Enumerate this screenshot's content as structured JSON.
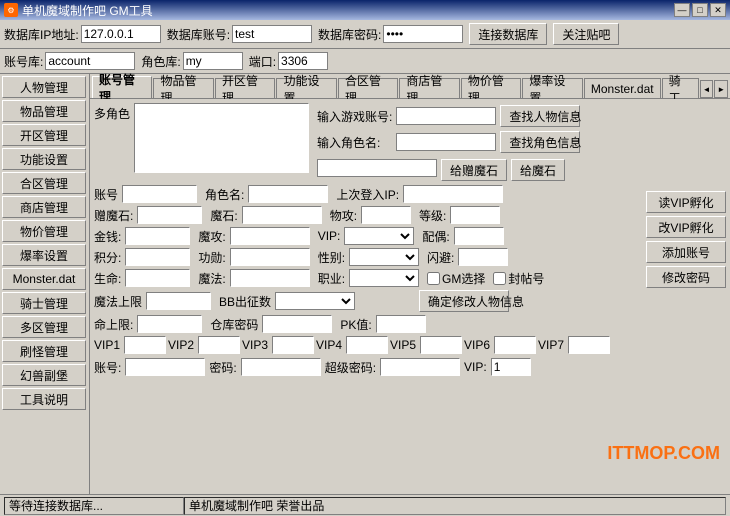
{
  "window": {
    "title": "单机魔域制作吧 GM工具",
    "icon": "⚙"
  },
  "title_buttons": {
    "minimize": "—",
    "maximize": "□",
    "close": "✕"
  },
  "menu": {
    "items": [
      "数据库IP地址:",
      "数据库账号:",
      "数据库密码:"
    ]
  },
  "toolbar": {
    "db_ip_label": "数据库IP地址:",
    "db_ip_value": "127.0.0.1",
    "db_account_label": "数据库账号:",
    "db_account_value": "test",
    "db_password_label": "数据库密码:",
    "db_password_value": "****",
    "connect_btn": "连接数据库",
    "close_btn": "关注贴吧"
  },
  "account_row": {
    "account_label": "账号库:",
    "account_value": "account",
    "role_label": "角色库:",
    "role_value": "my",
    "port_label": "端口:",
    "port_value": "3306"
  },
  "sidebar": {
    "items": [
      "人物管理",
      "物品管理",
      "开区管理",
      "功能设置",
      "合区管理",
      "商店管理",
      "物价管理",
      "爆率设置",
      "Monster.dat",
      "骑士管理",
      "多区管理",
      "刷怪管理",
      "幻兽副堡",
      "工具说明"
    ]
  },
  "tabs": {
    "items": [
      "账号管理",
      "物品管理",
      "开区管理",
      "功能设置",
      "合区管理",
      "商店管理",
      "物价管理",
      "爆率设置",
      "Monster.dat",
      "骑工"
    ],
    "active": 0,
    "scroll_left": "◄",
    "scroll_right": "►"
  },
  "account_tab": {
    "multi_char_label": "多角色",
    "search_game_account_label": "输入游戏账号:",
    "search_role_name_label": "输入角色名:",
    "find_person_btn": "查找人物信息",
    "find_role_btn": "查找角色信息",
    "gift_demon_stone_btn": "给赠魔石",
    "gift_demon_stone_btn2": "给魔石",
    "account_label": "账号",
    "role_name_label": "角色名:",
    "last_login_ip_label": "上次登入IP:",
    "donate_stone_label": "赠魔石:",
    "moshi_label": "魔石:",
    "phys_atk_label": "物攻:",
    "level_label": "等级:",
    "gold_label": "金钱:",
    "magic_label": "魔攻:",
    "vip_label_field": "VIP:",
    "partner_label": "配偶:",
    "points_label": "积分:",
    "merit_label": "功勋:",
    "gender_label": "性别:",
    "flash_label": "闪避:",
    "life_label": "生命:",
    "magic_val_label": "魔法:",
    "job_label": "职业:",
    "gm_select_label": "GM选择",
    "seal_label": "封帖号",
    "magic_upper_label": "魔法上限",
    "bb_output_label": "BB出征数",
    "max_life_label": "命上限:",
    "warehouse_pwd_label": "仓库密码",
    "pk_value_label": "PK值:",
    "confirm_btn": "确定修改人物信息",
    "read_vip_btn": "读VIP孵化",
    "change_vip_btn": "改VIP孵化",
    "add_account_btn": "添加账号",
    "change_pwd_btn": "修改密码",
    "vip_labels": [
      "VIP1",
      "VIP2",
      "VIP3",
      "VIP4",
      "VIP5",
      "VIP6",
      "VIP7"
    ],
    "bottom_account_label": "账号:",
    "bottom_password_label": "密码:",
    "bottom_super_pwd_label": "超级密码:",
    "bottom_vip_label": "VIP:",
    "bottom_vip_value": "1"
  },
  "status_bar": {
    "left_text": "等待连接数据库...",
    "right_text": "单机魔域制作吧 荣誉出品"
  },
  "watermark": "ITTMOP.COM"
}
